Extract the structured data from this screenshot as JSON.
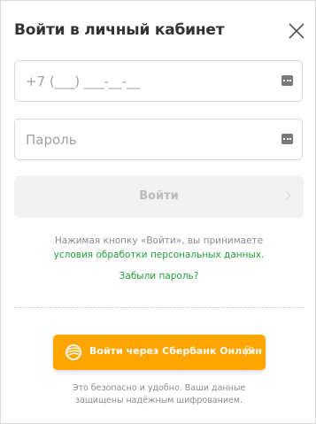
{
  "modal": {
    "title": "Войти в личный кабинет"
  },
  "phone_field": {
    "placeholder": "+7 (___) ___-__-__"
  },
  "password_field": {
    "placeholder": "Пароль"
  },
  "login_button": {
    "label": "Войти"
  },
  "consent": {
    "text": "Нажимая кнопку «Войти», вы принимаете",
    "link": "условия обработки персональных данных."
  },
  "forgot_password": "Забыли пароль?",
  "sber_button": {
    "label": "Войти через Сбербанк Онлайн",
    "beta": "β"
  },
  "security_note": {
    "line1": "Это безопасно и удобно. Ваши данные",
    "line2": "защищены надёжным шифрованием."
  },
  "colors": {
    "accent_green": "#21a038",
    "sber_orange": "#ffa500",
    "disabled_button_bg": "#f2f2f2"
  },
  "icons": {
    "close": "close-icon",
    "phone_autofill": "key-icon",
    "password_autofill": "key-icon",
    "login_arrow": "chevron-right-icon",
    "sber": "sber-logo-icon"
  }
}
